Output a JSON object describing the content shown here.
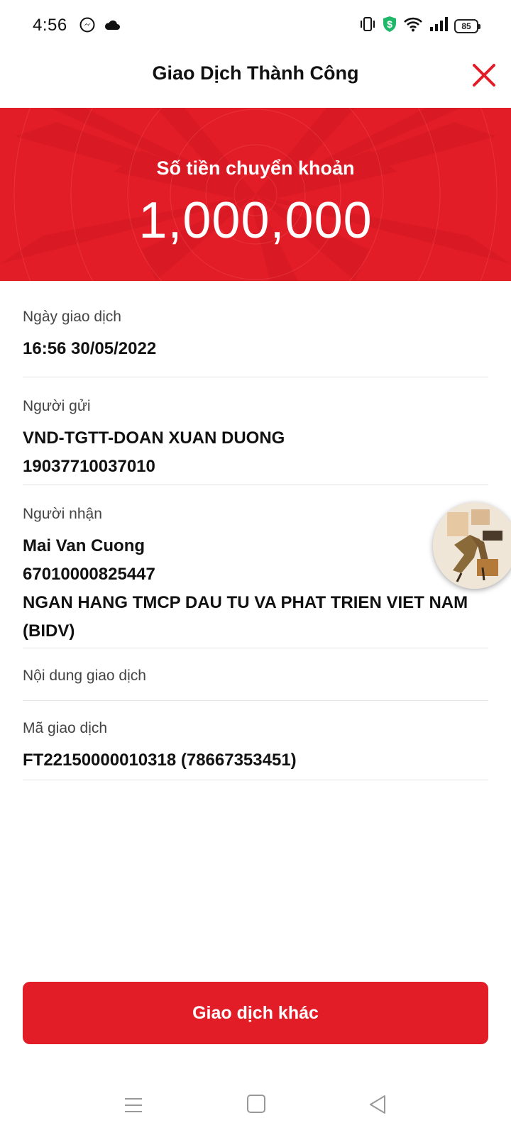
{
  "status_bar": {
    "time": "4:56",
    "battery": "85",
    "icons": [
      "messenger-icon",
      "cloud-icon",
      "vibrate-icon",
      "shield-dollar-icon",
      "wifi-icon",
      "signal-icon",
      "battery-icon"
    ]
  },
  "header": {
    "title": "Giao Dịch Thành Công",
    "close_icon": "close-icon"
  },
  "banner": {
    "label": "Số tiền chuyển khoản",
    "amount": "1,000,000"
  },
  "details": {
    "date": {
      "label": "Ngày giao dịch",
      "value": "16:56 30/05/2022"
    },
    "sender": {
      "label": "Người gửi",
      "line1": "VND-TGTT-DOAN XUAN DUONG",
      "line2": "19037710037010"
    },
    "recipient": {
      "label": "Người nhận",
      "name": "Mai Van Cuong",
      "account": "67010000825447",
      "bank": "NGAN HANG TMCP DAU TU VA PHAT TRIEN VIET NAM (BIDV)"
    },
    "content": {
      "label": "Nội dung giao dịch",
      "value": ""
    },
    "code": {
      "label": "Mã giao dịch",
      "value": "FT22150000010318 (78667353451)"
    }
  },
  "action_button": {
    "label": "Giao dịch khác"
  },
  "navbar": {
    "icons": [
      "menu-icon",
      "home-icon",
      "back-icon"
    ]
  },
  "colors": {
    "brand_red": "#e31d28",
    "divider": "#e4e4e4"
  }
}
